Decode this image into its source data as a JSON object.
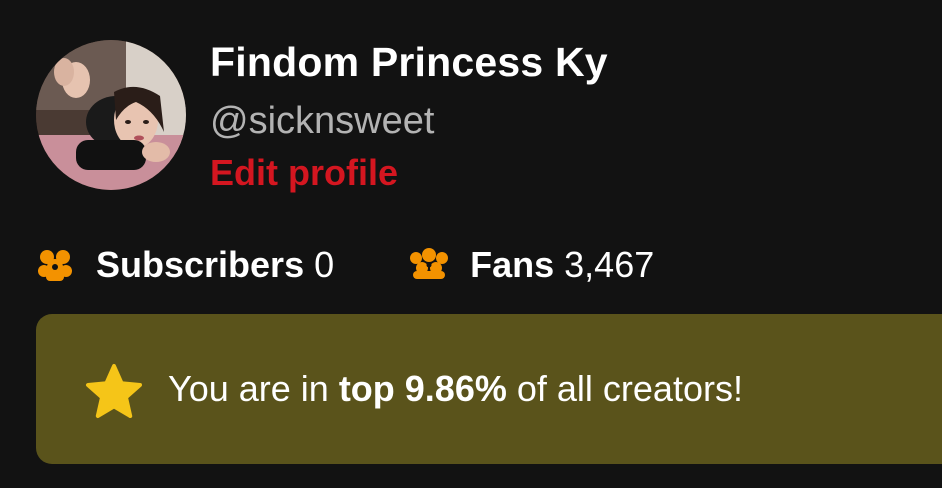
{
  "profile": {
    "display_name": "Findom Princess Ky",
    "username": "@sicknsweet",
    "edit_label": "Edit profile"
  },
  "stats": {
    "subscribers": {
      "label": "Subscribers",
      "value": "0",
      "icon": "subscribers-icon"
    },
    "fans": {
      "label": "Fans",
      "value": "3,467",
      "icon": "fans-icon"
    }
  },
  "banner": {
    "prefix": "You are in ",
    "highlight": "top 9.86%",
    "suffix": " of all creators!",
    "icon": "star-icon"
  },
  "colors": {
    "background": "#121212",
    "accent_red": "#d41620",
    "icon_orange": "#f39200",
    "banner_bg": "#5a531b",
    "star_yellow": "#f5c518",
    "muted_text": "#b3b3b3"
  }
}
